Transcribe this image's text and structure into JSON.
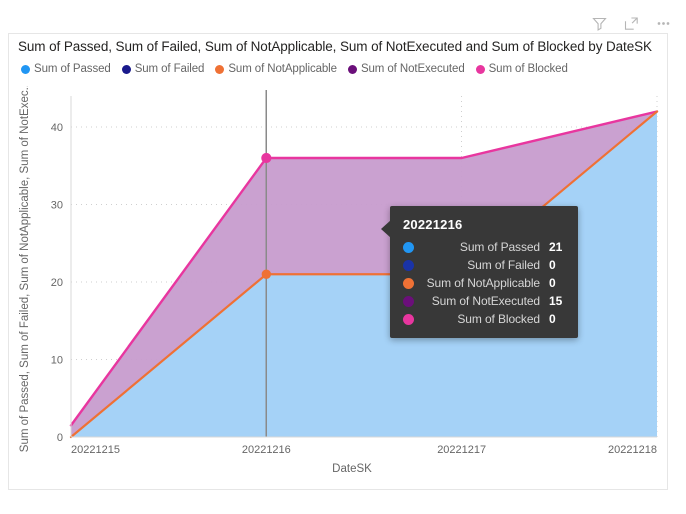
{
  "header": {
    "icons": [
      {
        "name": "filter-icon",
        "label": "Filters"
      },
      {
        "name": "focus-mode-icon",
        "label": "Focus mode"
      },
      {
        "name": "more-options-icon",
        "label": "More options"
      }
    ]
  },
  "visual": {
    "title": "Sum of Passed, Sum of Failed, Sum of NotApplicable, Sum of NotExecuted and Sum of Blocked by DateSK"
  },
  "legend": {
    "items": [
      {
        "label": "Sum of Passed",
        "color": "#2196f3"
      },
      {
        "label": "Sum of Failed",
        "color": "#1a1a8c"
      },
      {
        "label": "Sum of NotApplicable",
        "color": "#ef7135"
      },
      {
        "label": "Sum of NotExecuted",
        "color": "#6b0f7a"
      },
      {
        "label": "Sum of Blocked",
        "color": "#e8369f"
      }
    ]
  },
  "tooltip": {
    "title": "20221216",
    "rows": [
      {
        "name": "Sum of Passed",
        "value": "21",
        "color": "#2196f3"
      },
      {
        "name": "Sum of Failed",
        "value": "0",
        "color": "#1a33a8"
      },
      {
        "name": "Sum of NotApplicable",
        "value": "0",
        "color": "#ef7135"
      },
      {
        "name": "Sum of NotExecuted",
        "value": "15",
        "color": "#6b0f7a"
      },
      {
        "name": "Sum of Blocked",
        "value": "0",
        "color": "#e8369f"
      }
    ]
  },
  "chart_data": {
    "type": "area",
    "title": "Sum of Passed, Sum of Failed, Sum of NotApplicable, Sum of NotExecuted and Sum of Blocked by DateSK",
    "xlabel": "DateSK",
    "ylabel": "Sum of Passed, Sum of Failed, Sum of NotApplicable, Sum of NotExec...",
    "ylabel_full": "Sum of Passed, Sum of Failed, Sum of NotApplicable, Sum of NotExecuted and Sum of Blocked",
    "categories": [
      "20221215",
      "20221216",
      "20221217",
      "20221218"
    ],
    "x_tick_labels": [
      "20221215",
      "20221216",
      "20221217",
      "20221218"
    ],
    "y_tick_labels": [
      "0",
      "10",
      "20",
      "30",
      "40"
    ],
    "y_ticks": [
      0,
      10,
      20,
      30,
      40
    ],
    "ylim": [
      0,
      44
    ],
    "grid": true,
    "legend_position": "top-left",
    "stacked": false,
    "crosshair_at": "20221216",
    "series": [
      {
        "name": "Sum of Passed",
        "color": "#2196f3",
        "fill": "#a5d2f7",
        "values": [
          0,
          21,
          21,
          42
        ]
      },
      {
        "name": "Sum of Failed",
        "color": "#1a1a8c",
        "fill": "#1a1a8c",
        "values": [
          0,
          0,
          0,
          0
        ]
      },
      {
        "name": "Sum of NotApplicable",
        "color": "#ef7135",
        "fill": "#ef7135",
        "values": [
          0,
          21,
          21,
          42
        ]
      },
      {
        "name": "Sum of NotExecuted",
        "color": "#6b0f7a",
        "fill": "#c79cce",
        "values": [
          1.5,
          36,
          36,
          42
        ]
      },
      {
        "name": "Sum of Blocked",
        "color": "#e8369f",
        "fill": "#e8369f",
        "values": [
          1.5,
          36,
          36,
          42
        ]
      }
    ]
  }
}
